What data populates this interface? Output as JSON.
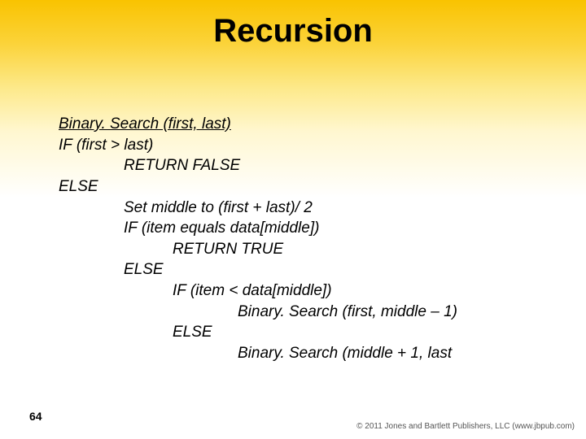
{
  "title": "Recursion",
  "page_number": "64",
  "copyright": "© 2011 Jones and Bartlett Publishers, LLC (www.jbpub.com)",
  "pseudo": {
    "l1": "Binary. Search (first, last)",
    "l2": "IF (first > last)",
    "l3": "RETURN FALSE",
    "l4": "ELSE",
    "l5": "Set middle to (first + last)/ 2",
    "l6": "IF (item equals data[middle])",
    "l7": "RETURN TRUE",
    "l8": "ELSE",
    "l9": "IF (item < data[middle])",
    "l10": "Binary. Search (first, middle – 1)",
    "l11": "ELSE",
    "l12": "Binary. Search (middle + 1, last"
  }
}
